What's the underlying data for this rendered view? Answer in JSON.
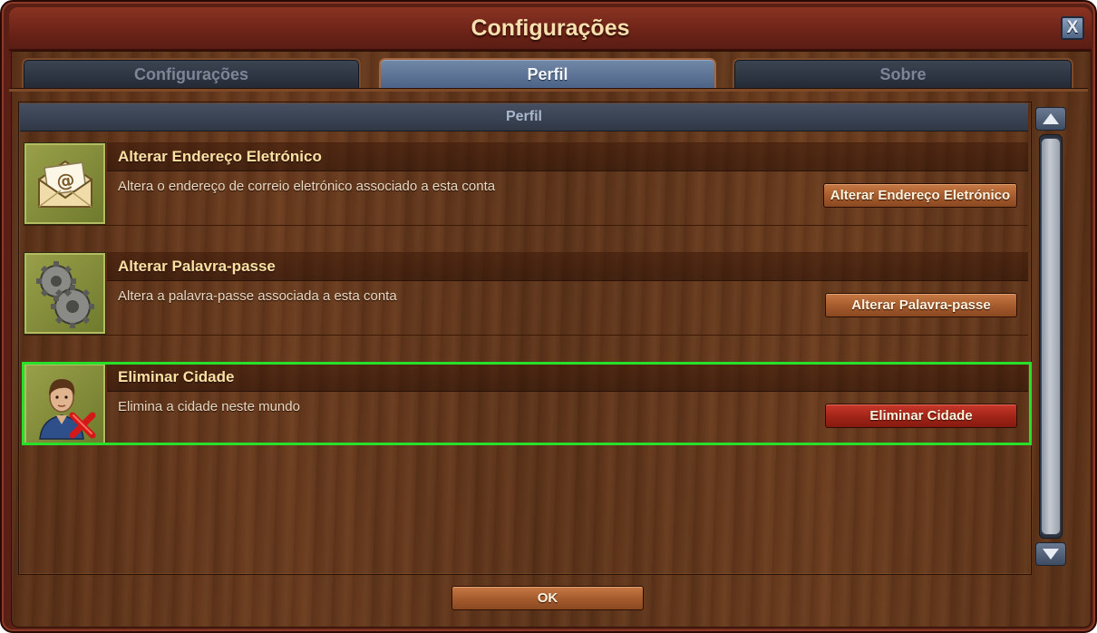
{
  "window": {
    "title": "Configurações",
    "close_label": "X"
  },
  "tabs": [
    {
      "label": "Configurações",
      "active": false
    },
    {
      "label": "Perfil",
      "active": true
    },
    {
      "label": "Sobre",
      "active": false
    }
  ],
  "section": {
    "title": "Perfil"
  },
  "rows": [
    {
      "title": "Alterar Endereço Eletrónico",
      "description": "Altera o endereço de correio eletrónico associado a esta conta",
      "button_label": "Alterar Endereço Eletrónico",
      "icon": "envelope-icon",
      "button_color": "#a45a2c"
    },
    {
      "title": "Alterar Palavra-passe",
      "description": "Altera a palavra-passe associada a esta conta",
      "button_label": "Alterar Palavra-passe",
      "icon": "gears-icon",
      "button_color": "#a45a2c"
    },
    {
      "title": "Eliminar Cidade",
      "description": "Elimina a cidade neste mundo",
      "button_label": "Eliminar Cidade",
      "icon": "delete-user-icon",
      "button_color": "#a02418",
      "highlighted": true
    }
  ],
  "footer": {
    "ok_label": "OK"
  },
  "colors": {
    "highlight": "#28e02a",
    "title_text": "#f8dfae",
    "row_title_text": "#fbe1a4"
  }
}
